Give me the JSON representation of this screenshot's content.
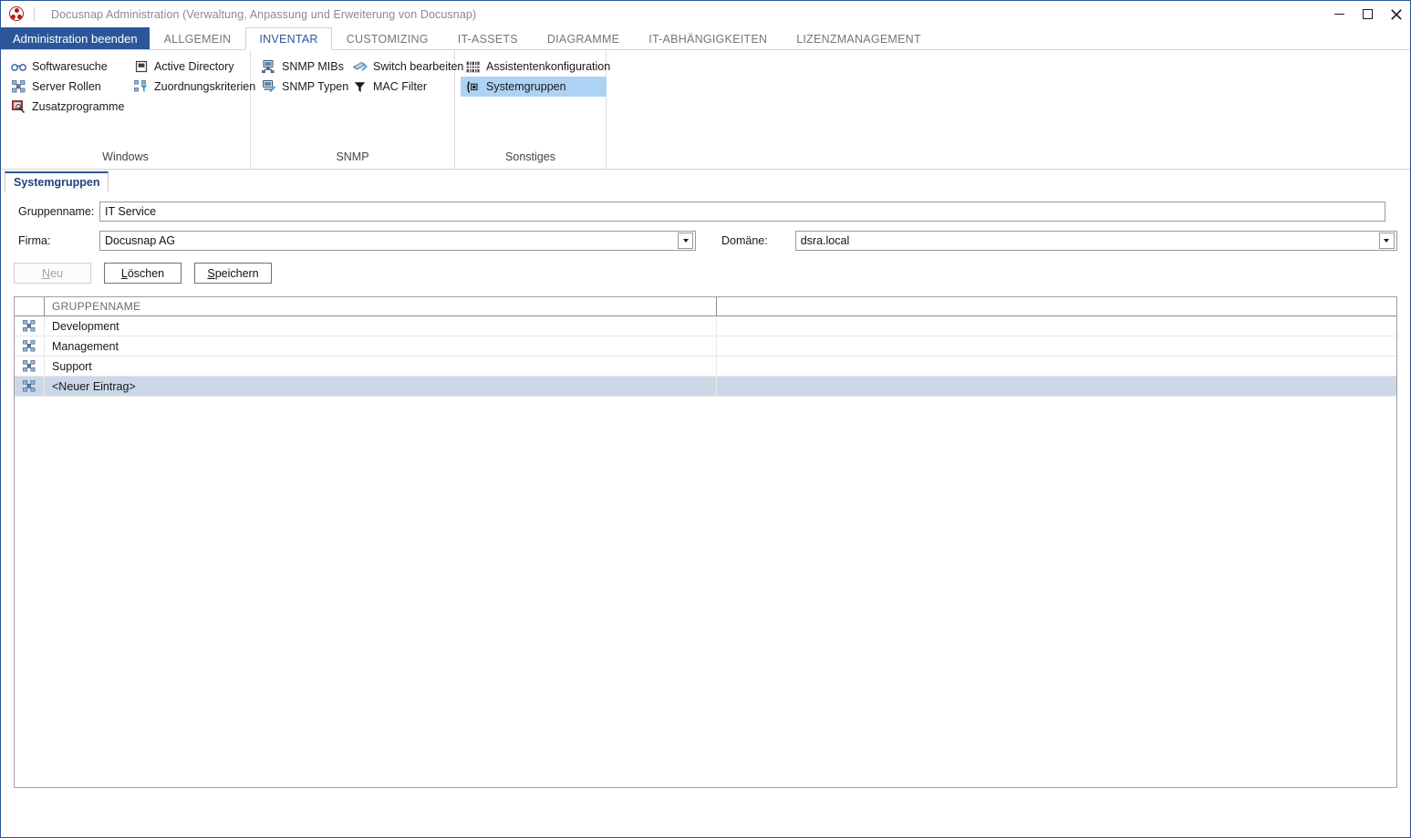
{
  "window": {
    "title": "Docusnap Administration (Verwaltung, Anpassung und Erweiterung von Docusnap)",
    "app_icon": "docusnap-logo-icon",
    "controls": {
      "minimize": "minimize-icon",
      "maximize": "maximize-icon",
      "close": "close-icon"
    },
    "frame_color": "#2b579a"
  },
  "ribbon": {
    "backstage_label": "Administration beenden",
    "tabs": [
      {
        "label": "ALLGEMEIN",
        "active": false
      },
      {
        "label": "INVENTAR",
        "active": true
      },
      {
        "label": "CUSTOMIZING",
        "active": false
      },
      {
        "label": "IT-ASSETS",
        "active": false
      },
      {
        "label": "DIAGRAMME",
        "active": false
      },
      {
        "label": "IT-ABHÄNGIGKEITEN",
        "active": false
      },
      {
        "label": "LIZENZMANAGEMENT",
        "active": false
      }
    ],
    "groups": [
      {
        "label": "Windows",
        "columns": [
          [
            {
              "label": "Softwaresuche",
              "icon": "glasses-icon",
              "selected": false
            },
            {
              "label": "Server Rollen",
              "icon": "server-roles-icon",
              "selected": false
            },
            {
              "label": "Zusatzprogramme",
              "icon": "extra-programs-icon",
              "selected": false
            }
          ],
          [
            {
              "label": "Active Directory",
              "icon": "active-directory-icon",
              "selected": false
            },
            {
              "label": "Zuordnungskriterien",
              "icon": "assignment-criteria-icon",
              "selected": false
            }
          ]
        ]
      },
      {
        "label": "SNMP",
        "columns": [
          [
            {
              "label": "SNMP MIBs",
              "icon": "snmp-mibs-icon",
              "selected": false
            },
            {
              "label": "SNMP Typen",
              "icon": "snmp-types-icon",
              "selected": false
            }
          ],
          [
            {
              "label": "Switch bearbeiten",
              "icon": "switch-edit-icon",
              "selected": false
            },
            {
              "label": "MAC Filter",
              "icon": "filter-icon",
              "selected": false
            }
          ]
        ]
      },
      {
        "label": "Sonstiges",
        "columns": [
          [
            {
              "label": "Assistentenkonfiguration",
              "icon": "wizard-config-icon",
              "selected": false
            },
            {
              "label": "Systemgruppen",
              "icon": "system-groups-icon",
              "selected": true
            }
          ]
        ]
      }
    ],
    "selected_color": "#aed2f4"
  },
  "page": {
    "tab_label": "Systemgruppen",
    "form": {
      "gruppenname": {
        "label": "Gruppenname:",
        "value": "IT Service",
        "placeholder": ""
      },
      "firma": {
        "label": "Firma:",
        "value": "Docusnap AG"
      },
      "domaene": {
        "label": "Domäne:",
        "value": "dsra.local"
      }
    },
    "buttons": {
      "neu": {
        "label": "Neu",
        "disabled": true
      },
      "loeschen": {
        "label": "Löschen",
        "disabled": false
      },
      "speichern": {
        "label": "Speichern",
        "disabled": false
      }
    },
    "grid": {
      "headers": [
        "",
        "GRUPPENNAME",
        ""
      ],
      "row_icon": "system-group-row-icon",
      "rows": [
        {
          "name": "Development",
          "selected": false
        },
        {
          "name": "Management",
          "selected": false
        },
        {
          "name": "Support",
          "selected": false
        },
        {
          "name": "<Neuer Eintrag>",
          "selected": true
        }
      ],
      "selected_row_color": "#ccd8e8"
    }
  }
}
